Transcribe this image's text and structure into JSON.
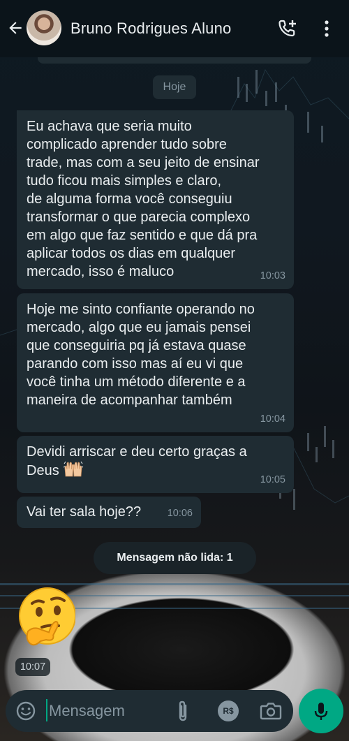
{
  "header": {
    "contact_name": "Bruno Rodrigues Aluno"
  },
  "date_chip": "Hoje",
  "messages": [
    {
      "text": "Eu achava que seria muito\ncomplicado aprender tudo sobre\ntrade, mas com a seu jeito de ensinar\ntudo ficou mais simples e claro,\nde alguma forma você conseguiu\ntransformar o que parecia complexo\nem algo que faz sentido e que dá pra\naplicar todos os dias em qualquer\nmercado, isso é maluco",
      "time": "10:03"
    },
    {
      "text": "Hoje me sinto confiante operando no\nmercado, algo que eu jamais pensei\nque conseguiria pq já estava quase\nparando com isso mas aí eu vi que\nvocê tinha um método diferente e a\nmaneira de acompanhar também",
      "time": "10:04"
    },
    {
      "text": "Devidi arriscar e deu certo graças a\nDeus",
      "emoji": "raising-hands",
      "time": "10:05"
    },
    {
      "text": "Vai ter sala hoje??",
      "time": "10:06"
    }
  ],
  "unread_label": "Mensagem não lida: 1",
  "sticker": {
    "emoji": "thinking-face",
    "time": "10:07"
  },
  "input": {
    "placeholder": "Mensagem",
    "value": ""
  },
  "icons": {
    "back": "arrow-left-icon",
    "call_add": "phone-plus-icon",
    "menu": "more-vertical-icon",
    "emoji": "emoji-icon",
    "attach": "paperclip-icon",
    "payment": "rs-payment-icon",
    "camera": "camera-icon",
    "mic": "mic-icon"
  },
  "payment_label": "R$",
  "colors": {
    "header_bg": "#0b141a",
    "bubble_bg": "#1f2c33",
    "accent": "#00a884",
    "text_primary": "#e9edef",
    "text_secondary": "#8696a0"
  }
}
